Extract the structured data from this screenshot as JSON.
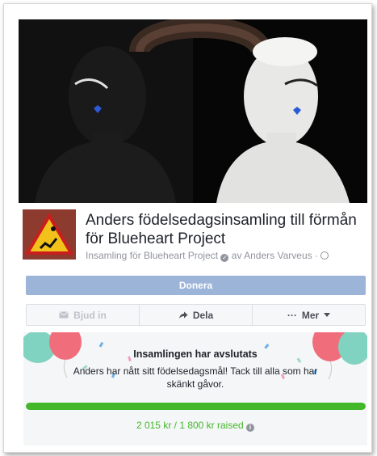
{
  "fundraiser": {
    "title": "Anders födelsedagsinsamling till förmån för Blueheart Project",
    "subline_prefix": "Insamling för Blueheart Project",
    "subline_by": "av Anders Varveus ·"
  },
  "actions": {
    "donate_label": "Donera",
    "invite_label": "Bjud in",
    "share_label": "Dela",
    "more_label": "Mer"
  },
  "closed": {
    "title": "Insamlingen har avslutats",
    "message": "Anders har nått sitt födelsedagsmål! Tack till alla som har skänkt gåvor.",
    "progress_fraction": 1.0,
    "raised_text": "2 015 kr / 1 800 kr raised"
  },
  "colors": {
    "accent_blue": "#9cb4d8",
    "progress_green": "#42b72a",
    "muted_text": "#90949c"
  },
  "icons": [
    "envelope-icon",
    "share-arrow-icon",
    "more-dots-icon",
    "chevron-down-icon",
    "verified-check-icon",
    "globe-icon",
    "info-icon"
  ]
}
